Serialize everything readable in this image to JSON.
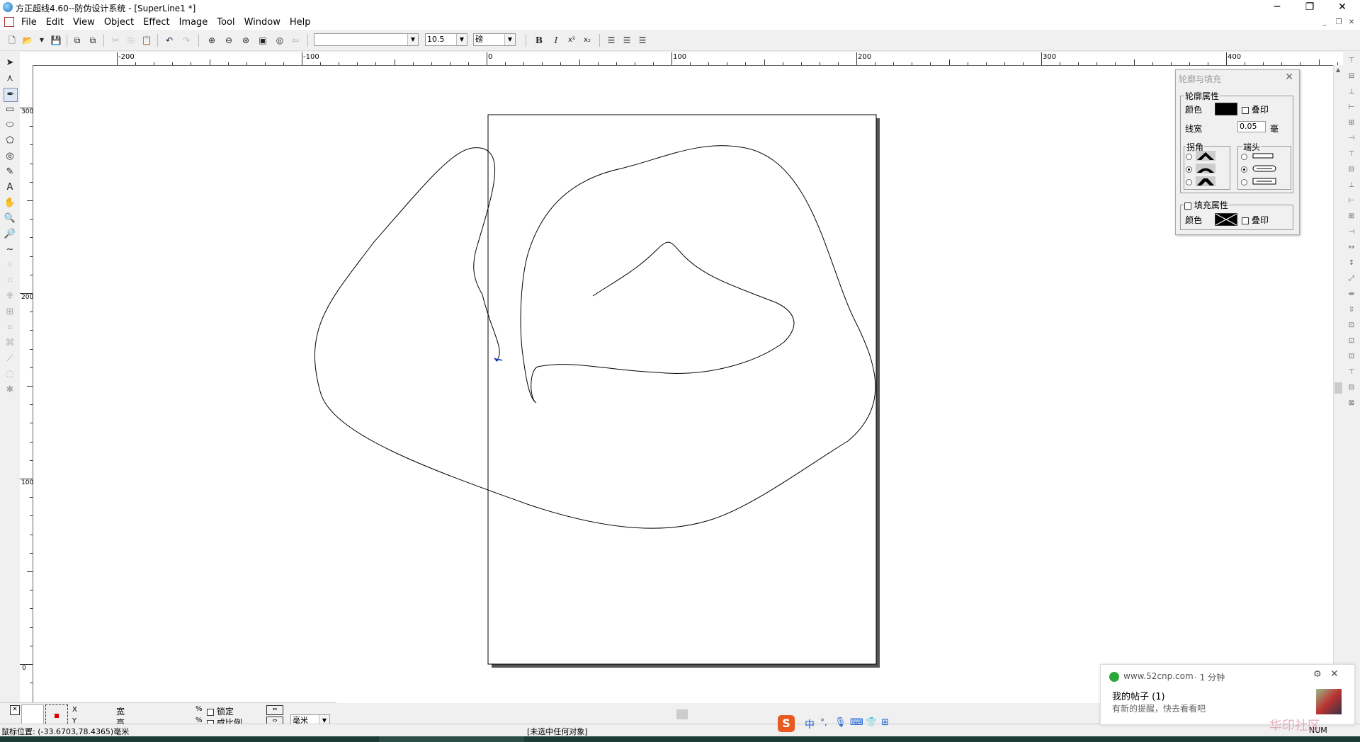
{
  "window": {
    "title": "方正超线4.60--防伪设计系统 - [SuperLine1  *]",
    "controls": {
      "minimize": "─",
      "restore": "❐",
      "close": "✕"
    }
  },
  "menu": {
    "items": [
      "File",
      "Edit",
      "View",
      "Object",
      "Effect",
      "Image",
      "Tool",
      "Window",
      "Help"
    ],
    "mdi_controls": {
      "minimize": "_",
      "restore": "❐",
      "close": "✕"
    }
  },
  "toolbar": {
    "font_name": "",
    "font_size": "10.5",
    "font_style": "磅",
    "bold": "B",
    "italic": "I",
    "superscript": "x²",
    "subscript": "x₂"
  },
  "ruler": {
    "h_labels": [
      "-200",
      "-100",
      "0",
      "100",
      "200",
      "300",
      "400"
    ],
    "v_labels": [
      "300",
      "200",
      "100",
      "0"
    ]
  },
  "panel": {
    "title": "轮廓与填充",
    "outline_group": "轮廓属性",
    "color_label": "颜色",
    "overprint_label": "叠印",
    "width_label": "线宽",
    "width_value": "0.05",
    "width_unit": "毫",
    "corner_group": "拐角",
    "cap_group": "端头",
    "fill_group": "填充属性",
    "fill_color_label": "颜色",
    "fill_overprint_label": "叠印",
    "outline_color": "#000000"
  },
  "propbar": {
    "x_label": "X",
    "y_label": "Y",
    "w_label": "宽",
    "h_label": "高",
    "pct1": "%",
    "pct2": "%",
    "lock_label": "锁定",
    "proportional_label": "成比例",
    "unit": "毫米"
  },
  "status": {
    "mouse_position": "鼠标位置: (-33.6703,78.4365)毫米",
    "selection": "[未选中任何对象]",
    "num": "NUM"
  },
  "ime": {
    "chinese": "中"
  },
  "notification": {
    "site": "www.52cnp.com",
    "time": "· 1 分钟",
    "headline": "我的帖子 (1)",
    "message": "有新的提醒，快去看看吧",
    "watermark": "华印社区"
  },
  "icons": {
    "zoom_in": "zoom-in-icon",
    "zoom_out": "zoom-out-icon"
  }
}
